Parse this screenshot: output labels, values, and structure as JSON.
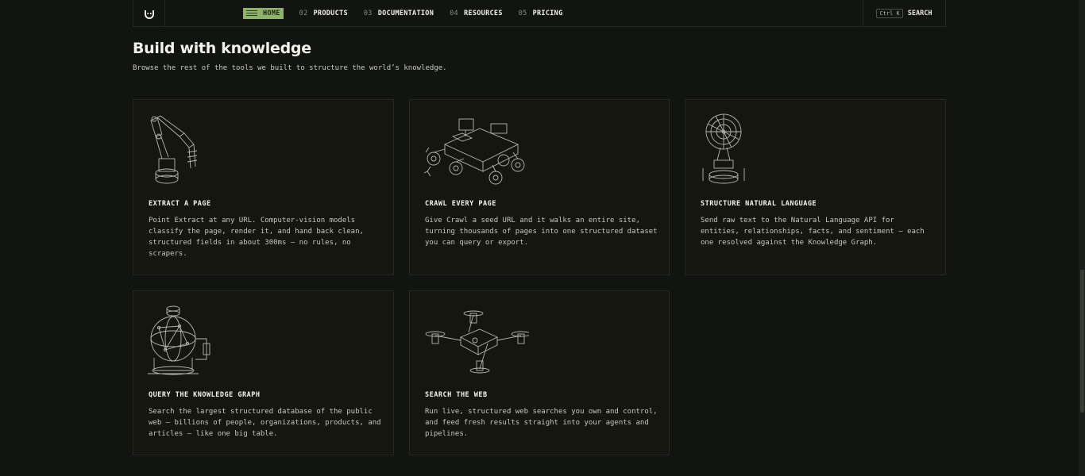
{
  "nav": {
    "items": [
      {
        "num": "",
        "label": "HOME",
        "active": true
      },
      {
        "num": "02",
        "label": "PRODUCTS"
      },
      {
        "num": "03",
        "label": "DOCUMENTATION"
      },
      {
        "num": "04",
        "label": "RESOURCES"
      },
      {
        "num": "05",
        "label": "PRICING"
      }
    ],
    "search": {
      "kbd": "Ctrl K",
      "label": "SEARCH"
    }
  },
  "section": {
    "title": "Build with knowledge",
    "subtitle": "Browse the rest of the tools we built to structure the world’s knowledge."
  },
  "cards": [
    {
      "title": "EXTRACT A PAGE",
      "desc": "Point Extract at any URL. Computer-vision models classify the page, render it, and hand back clean, structured fields in about 300ms — no rules, no scrapers.",
      "icon": "robot-arm-icon"
    },
    {
      "title": "CRAWL EVERY PAGE",
      "desc": "Give Crawl a seed URL and it walks an entire site, turning thousands of pages into one structured dataset you can query or export.",
      "icon": "rover-icon"
    },
    {
      "title": "STRUCTURE NATURAL LANGUAGE",
      "desc": "Send raw text to the Natural Language API for entities, relationships, facts, and sentiment — each one resolved against the Knowledge Graph.",
      "icon": "satellite-dish-icon"
    },
    {
      "title": "QUERY THE KNOWLEDGE GRAPH",
      "desc": "Search the largest structured database of the public web — billions of people, organizations, products, and articles — like one big table.",
      "icon": "globe-machine-icon"
    },
    {
      "title": "SEARCH THE WEB",
      "desc": "Run live, structured web searches you own and control, and feed fresh results straight into your agents and pipelines.",
      "icon": "drone-icon"
    }
  ],
  "colors": {
    "background": "#121410",
    "accent": "#8fb36b",
    "border": "#262923"
  }
}
